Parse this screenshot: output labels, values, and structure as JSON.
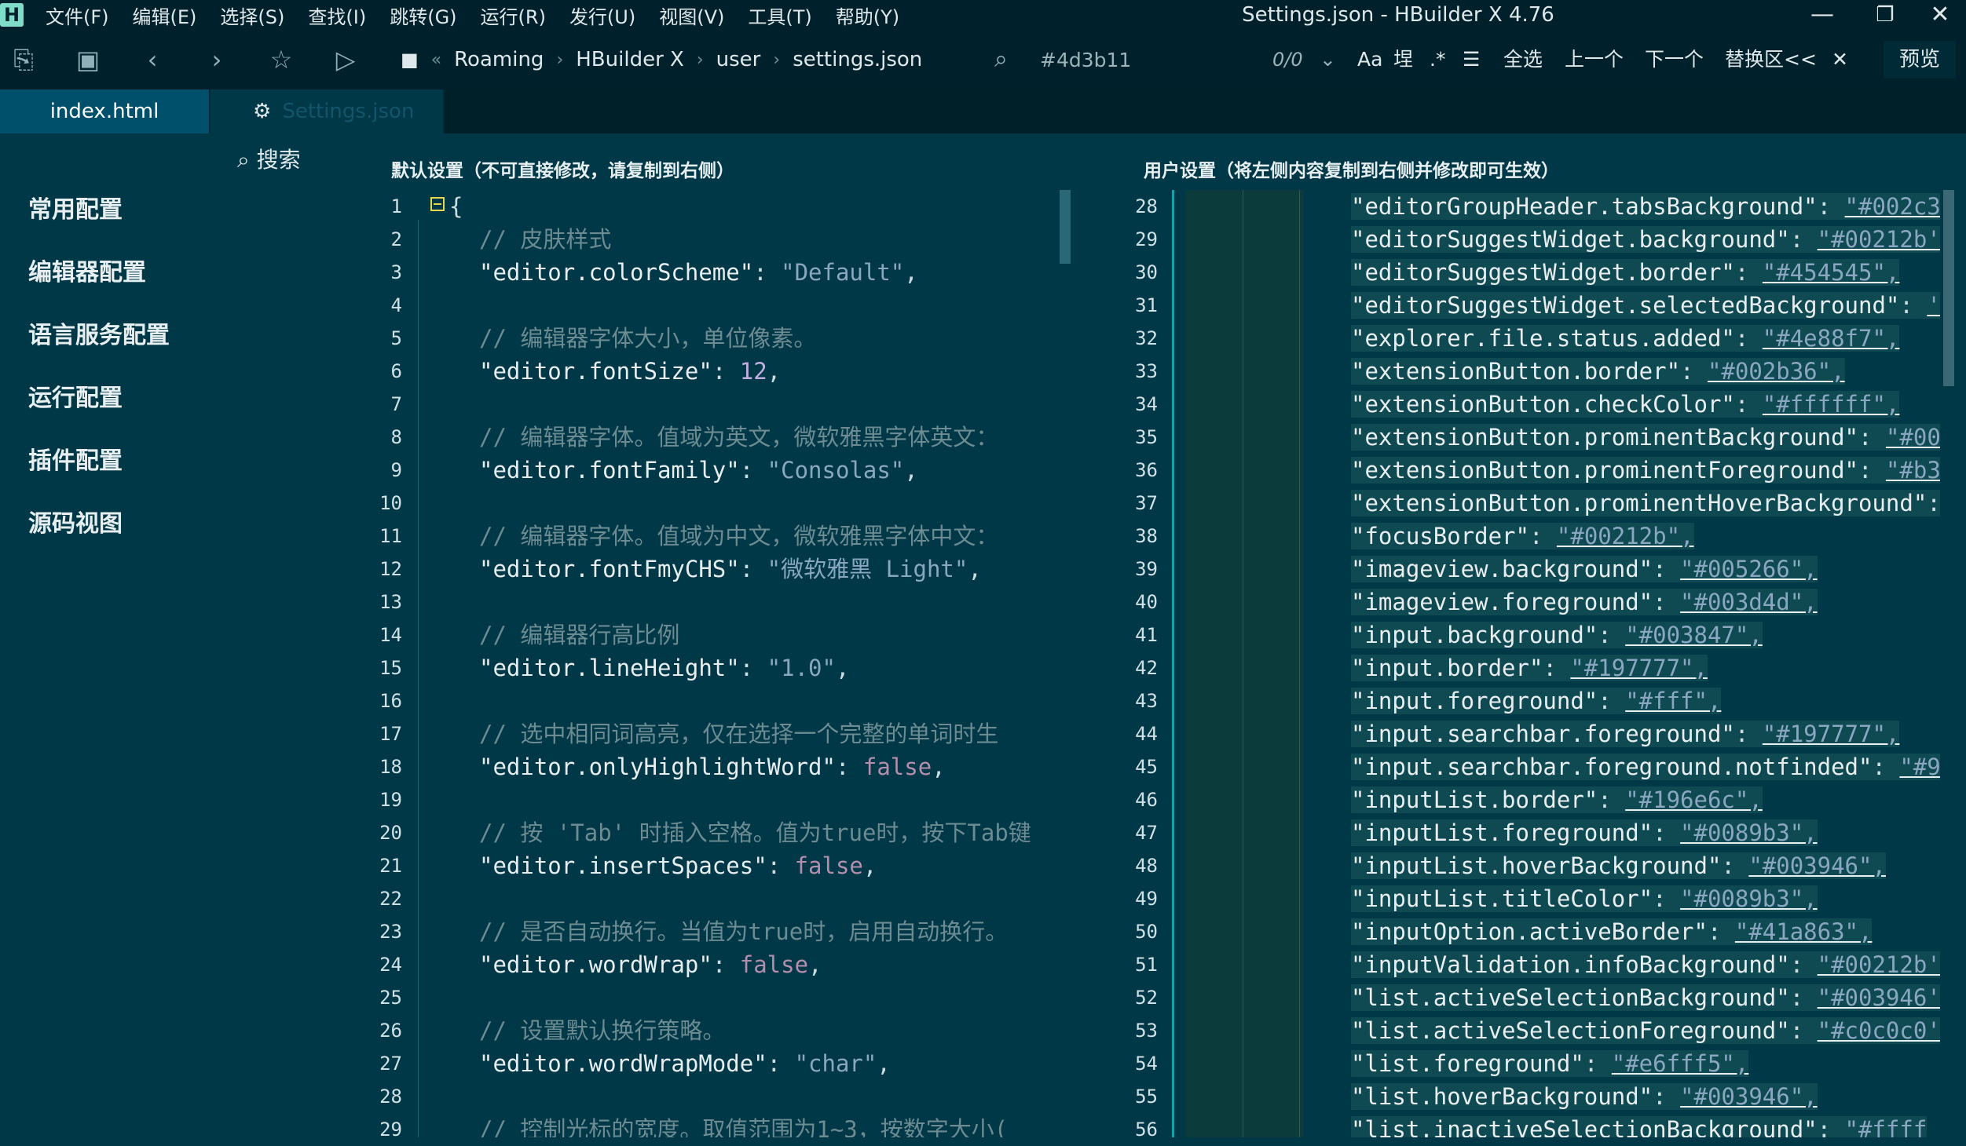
{
  "app": {
    "logo": "H",
    "title": "Settings.json - HBuilder X 4.76",
    "menu": [
      "文件(F)",
      "编辑(E)",
      "选择(S)",
      "查找(I)",
      "跳转(G)",
      "运行(R)",
      "发行(U)",
      "视图(V)",
      "工具(T)",
      "帮助(Y)"
    ],
    "window_buttons": {
      "minimize": "—",
      "maximize": "❐",
      "close": "✕"
    }
  },
  "toolbar": {
    "icons": [
      "new-file-icon",
      "save-icon",
      "back-icon",
      "forward-icon",
      "star-icon",
      "run-icon"
    ],
    "breadcrumb": [
      "Roaming",
      "HBuilder X",
      "user",
      "settings.json"
    ],
    "find_value": "#4d3b11",
    "find_count": "0/0",
    "find_tools": {
      "case": "Aa",
      "word": "㘿",
      "regex": ".*",
      "select_all": "全选",
      "prev": "上一个",
      "next": "下一个",
      "replace": "替换区<<",
      "close": "✕"
    },
    "preview": "预览"
  },
  "tabs": [
    {
      "label": "index.html",
      "active": true
    },
    {
      "label": "Settings.json",
      "active": false
    }
  ],
  "sidebar": {
    "search_label": "搜索",
    "items": [
      "常用配置",
      "编辑器配置",
      "语言服务配置",
      "运行配置",
      "插件配置",
      "源码视图"
    ]
  },
  "left_pane": {
    "title": "默认设置（不可直接修改，请复制到右侧）",
    "lines": [
      {
        "n": "1",
        "kind": "brace",
        "text": "{"
      },
      {
        "n": "2",
        "kind": "comment",
        "text": "// 皮肤样式"
      },
      {
        "n": "3",
        "kind": "kv",
        "key": "\"editor.colorScheme\"",
        "value": "\"Default\"",
        "vtype": "s"
      },
      {
        "n": "4",
        "kind": "blank",
        "text": ""
      },
      {
        "n": "5",
        "kind": "comment",
        "text": "// 编辑器字体大小，单位像素。"
      },
      {
        "n": "6",
        "kind": "kv",
        "key": "\"editor.fontSize\"",
        "value": "12",
        "vtype": "n"
      },
      {
        "n": "7",
        "kind": "blank",
        "text": ""
      },
      {
        "n": "8",
        "kind": "comment",
        "text": "// 编辑器字体。值域为英文，微软雅黑字体英文："
      },
      {
        "n": "9",
        "kind": "kv",
        "key": "\"editor.fontFamily\"",
        "value": "\"Consolas\"",
        "vtype": "s"
      },
      {
        "n": "10",
        "kind": "blank",
        "text": ""
      },
      {
        "n": "11",
        "kind": "comment",
        "text": "// 编辑器字体。值域为中文，微软雅黑字体中文："
      },
      {
        "n": "12",
        "kind": "kv",
        "key": "\"editor.fontFmyCHS\"",
        "value": "\"微软雅黑 Light\"",
        "vtype": "s"
      },
      {
        "n": "13",
        "kind": "blank",
        "text": ""
      },
      {
        "n": "14",
        "kind": "comment",
        "text": "// 编辑器行高比例"
      },
      {
        "n": "15",
        "kind": "kv",
        "key": "\"editor.lineHeight\"",
        "value": "\"1.0\"",
        "vtype": "s"
      },
      {
        "n": "16",
        "kind": "blank",
        "text": ""
      },
      {
        "n": "17",
        "kind": "comment",
        "text": "// 选中相同词高亮，仅在选择一个完整的单词时生"
      },
      {
        "n": "18",
        "kind": "kv",
        "key": "\"editor.onlyHighlightWord\"",
        "value": "false",
        "vtype": "b"
      },
      {
        "n": "19",
        "kind": "blank",
        "text": ""
      },
      {
        "n": "20",
        "kind": "comment",
        "text": "// 按 'Tab' 时插入空格。值为true时，按下Tab键"
      },
      {
        "n": "21",
        "kind": "kv",
        "key": "\"editor.insertSpaces\"",
        "value": "false",
        "vtype": "b"
      },
      {
        "n": "22",
        "kind": "blank",
        "text": ""
      },
      {
        "n": "23",
        "kind": "comment",
        "text": "// 是否自动换行。当值为true时，启用自动换行。"
      },
      {
        "n": "24",
        "kind": "kv",
        "key": "\"editor.wordWrap\"",
        "value": "false",
        "vtype": "b"
      },
      {
        "n": "25",
        "kind": "blank",
        "text": ""
      },
      {
        "n": "26",
        "kind": "comment",
        "text": "// 设置默认换行策略。"
      },
      {
        "n": "27",
        "kind": "kv",
        "key": "\"editor.wordWrapMode\"",
        "value": "\"char\"",
        "vtype": "s"
      },
      {
        "n": "28",
        "kind": "blank",
        "text": ""
      },
      {
        "n": "29",
        "kind": "comment",
        "text": "// 控制光标的宽度。取值范围为1~3，按数字大小("
      }
    ]
  },
  "right_pane": {
    "title": "用户设置（将左侧内容复制到右侧并修改即可生效）",
    "lines": [
      {
        "n": "28",
        "key": "\"editorGroupHeader.tabsBackground\"",
        "value": "\"#002c3"
      },
      {
        "n": "29",
        "key": "\"editorSuggestWidget.background\"",
        "value": "\"#00212b'"
      },
      {
        "n": "30",
        "key": "\"editorSuggestWidget.border\"",
        "value": "\"#454545\","
      },
      {
        "n": "31",
        "key": "\"editorSuggestWidget.selectedBackground\"",
        "value": "'"
      },
      {
        "n": "32",
        "key": "\"explorer.file.status.added\"",
        "value": "\"#4e88f7\","
      },
      {
        "n": "33",
        "key": "\"extensionButton.border\"",
        "value": "\"#002b36\","
      },
      {
        "n": "34",
        "key": "\"extensionButton.checkColor\"",
        "value": "\"#ffffff\","
      },
      {
        "n": "35",
        "key": "\"extensionButton.prominentBackground\"",
        "value": "\"#00"
      },
      {
        "n": "36",
        "key": "\"extensionButton.prominentForeground\"",
        "value": "\"#b3"
      },
      {
        "n": "37",
        "key": "\"extensionButton.prominentHoverBackground\"",
        "value": ""
      },
      {
        "n": "38",
        "key": "\"focusBorder\"",
        "value": "\"#00212b\","
      },
      {
        "n": "39",
        "key": "\"imageview.background\"",
        "value": "\"#005266\","
      },
      {
        "n": "40",
        "key": "\"imageview.foreground\"",
        "value": "\"#003d4d\","
      },
      {
        "n": "41",
        "key": "\"input.background\"",
        "value": "\"#003847\","
      },
      {
        "n": "42",
        "key": "\"input.border\"",
        "value": "\"#197777\","
      },
      {
        "n": "43",
        "key": "\"input.foreground\"",
        "value": "\"#fff\","
      },
      {
        "n": "44",
        "key": "\"input.searchbar.foreground\"",
        "value": "\"#197777\","
      },
      {
        "n": "45",
        "key": "\"input.searchbar.foreground.notfinded\"",
        "value": "\"#9"
      },
      {
        "n": "46",
        "key": "\"inputList.border\"",
        "value": "\"#196e6c\","
      },
      {
        "n": "47",
        "key": "\"inputList.foreground\"",
        "value": "\"#0089b3\","
      },
      {
        "n": "48",
        "key": "\"inputList.hoverBackground\"",
        "value": "\"#003946\","
      },
      {
        "n": "49",
        "key": "\"inputList.titleColor\"",
        "value": "\"#0089b3\","
      },
      {
        "n": "50",
        "key": "\"inputOption.activeBorder\"",
        "value": "\"#41a863\","
      },
      {
        "n": "51",
        "key": "\"inputValidation.infoBackground\"",
        "value": "\"#00212b'"
      },
      {
        "n": "52",
        "key": "\"list.activeSelectionBackground\"",
        "value": "\"#003946'"
      },
      {
        "n": "53",
        "key": "\"list.activeSelectionForeground\"",
        "value": "\"#c0c0c0'"
      },
      {
        "n": "54",
        "key": "\"list.foreground\"",
        "value": "\"#e6fff5\","
      },
      {
        "n": "55",
        "key": "\"list.hoverBackground\"",
        "value": "\"#003946\","
      },
      {
        "n": "56",
        "key": "\"list.inactiveSelectionBackground\"",
        "value": "\"#ffff"
      }
    ]
  },
  "colors": {
    "menubar_bg": "#00212b",
    "editor_bg": "#003847",
    "active_tab_bg": "#00506b",
    "divider": "#1aa0a8"
  }
}
